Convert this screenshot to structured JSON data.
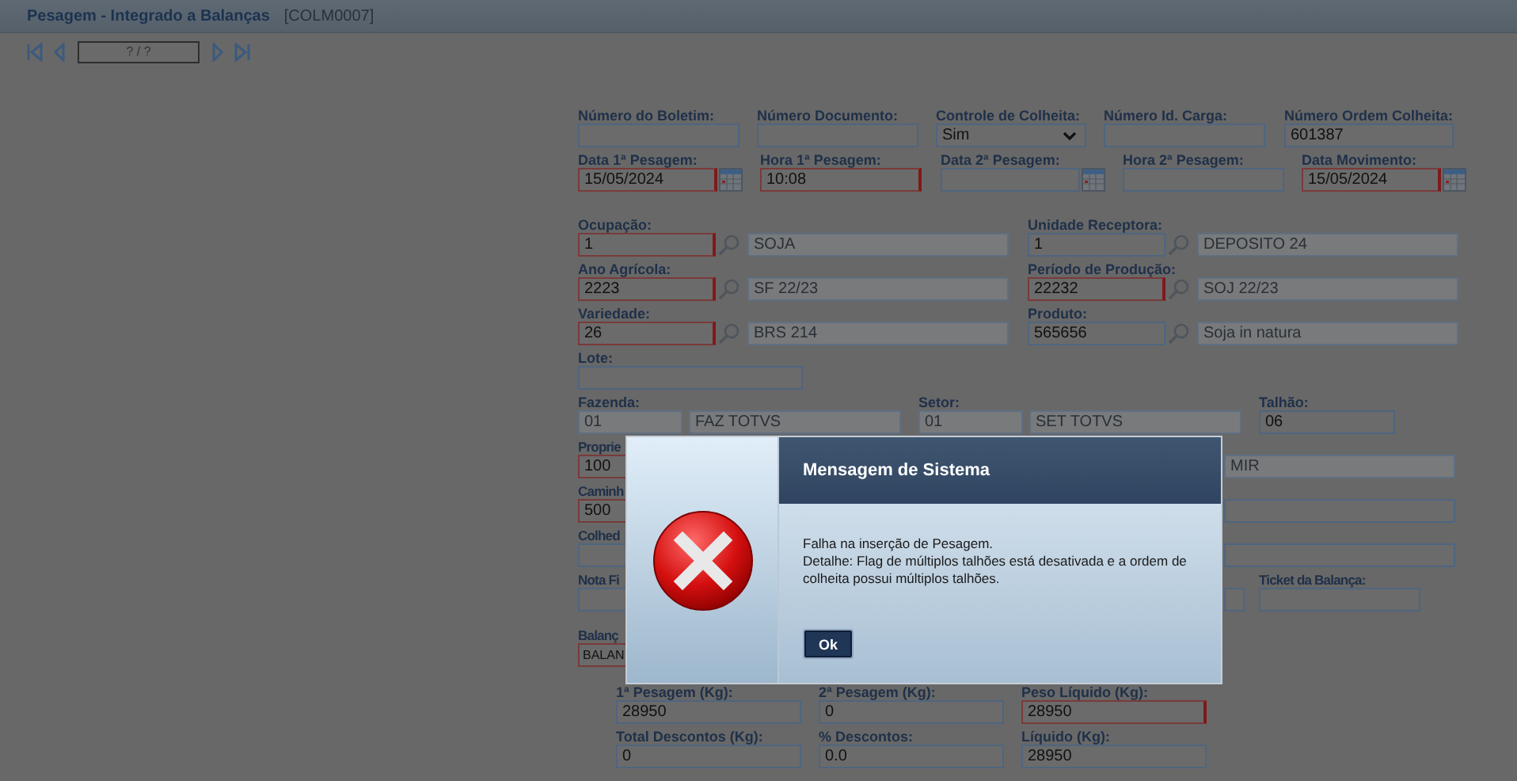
{
  "header": {
    "title": "Pesagem - Integrado a Balanças",
    "code": "[COLM0007]"
  },
  "pager": {
    "text": "? / ?"
  },
  "rows": [
    [
      {
        "kind": "text",
        "label": "Número do Boletim:",
        "required": false,
        "disabled": false
      },
      {
        "kind": "text",
        "label": "Número Documento:",
        "required": false,
        "disabled": false
      },
      {
        "kind": "select",
        "label": "Controle de Colheita:",
        "value": "Sim",
        "required": false,
        "disabled": false
      },
      {
        "kind": "text",
        "label": "Número Id. Carga:",
        "required": false,
        "disabled": false
      },
      {
        "kind": "text",
        "label": "Número Ordem Colheita:",
        "value": "601387",
        "required": false,
        "disabled": false
      }
    ],
    [
      {
        "kind": "date",
        "label": "Data 1ª Pesagem:",
        "value": "15/05/2024",
        "required": true,
        "disabled": false
      },
      {
        "kind": "text",
        "label": "Hora 1ª Pesagem:",
        "value": "10:08",
        "required": true,
        "disabled": false
      },
      {
        "kind": "date",
        "label": "Data 2ª Pesagem:",
        "required": false,
        "disabled": false
      },
      {
        "kind": "text",
        "label": "Hora 2ª Pesagem:",
        "required": false,
        "disabled": false
      },
      {
        "kind": "date",
        "label": "Data Movimento:",
        "value": "15/05/2024",
        "required": true,
        "disabled": false
      }
    ],
    [
      {
        "kind": "lookup",
        "label": "Ocupação:",
        "code": "1",
        "description": "SOJA",
        "required": true,
        "disabled": false
      },
      {
        "kind": "lookup",
        "label": "Unidade Receptora:",
        "code": "1",
        "description": "DEPOSITO 24",
        "required": false,
        "disabled": false
      }
    ],
    [
      {
        "kind": "lookup",
        "label": "Ano Agrícola:",
        "code": "2223",
        "description": "SF 22/23",
        "required": true,
        "disabled": false
      },
      {
        "kind": "lookup",
        "label": "Período de Produção:",
        "code": "22232",
        "description": "SOJ 22/23",
        "required": true,
        "disabled": false
      }
    ],
    [
      {
        "kind": "lookup",
        "label": "Variedade:",
        "code": "26",
        "description": "BRS 214",
        "required": true,
        "disabled": false
      },
      {
        "kind": "lookup",
        "label": "Produto:",
        "code": "565656",
        "description": "Soja in natura",
        "required": false,
        "disabled": false
      }
    ],
    [
      {
        "kind": "text",
        "label": "Lote:",
        "required": false,
        "disabled": false
      }
    ],
    [
      {
        "kind": "pair",
        "label": "Fazenda:",
        "code": "01",
        "description": "FAZ TOTVS",
        "required": false,
        "disabled": true
      },
      {
        "kind": "pair",
        "label": "Setor:",
        "code": "01",
        "description": "SET TOTVS",
        "required": false,
        "disabled": true
      },
      {
        "kind": "text",
        "label": "Talhão:",
        "value": "06",
        "required": false,
        "disabled": false
      }
    ],
    [
      {
        "kind": "text",
        "label": "Proprie",
        "value": "100",
        "required": true,
        "disabled": false
      },
      {
        "kind": "text",
        "value": "MIR",
        "required": false,
        "disabled": true
      }
    ],
    [
      {
        "kind": "text",
        "label": "Caminh",
        "value": "500",
        "required": true,
        "disabled": false
      },
      {
        "kind": "text",
        "required": false,
        "disabled": false
      }
    ],
    [
      {
        "kind": "text",
        "label": "Colhed",
        "required": false,
        "disabled": false
      },
      {
        "kind": "text",
        "required": false,
        "disabled": false
      }
    ],
    [
      {
        "kind": "text",
        "label": "Nota Fi",
        "required": false,
        "disabled": false
      },
      {
        "kind": "text",
        "required": false,
        "disabled": false
      },
      {
        "kind": "text",
        "label": "Ticket da Balança:",
        "required": false,
        "disabled": false
      }
    ],
    [
      {
        "kind": "text",
        "label": "Balanç",
        "value": "BALAN",
        "required": true,
        "disabled": false
      }
    ],
    [
      {
        "kind": "text",
        "label": "1ª Pesagem (Kg):",
        "value": "28950",
        "required": false,
        "disabled": false
      },
      {
        "kind": "text",
        "label": "2ª Pesagem (Kg):",
        "value": "0",
        "required": false,
        "disabled": false
      },
      {
        "kind": "text",
        "label": "Peso Líquido (Kg):",
        "value": "28950",
        "required": true,
        "disabled": false
      }
    ],
    [
      {
        "kind": "text",
        "label": "Total Descontos (Kg):",
        "value": "0",
        "required": false,
        "disabled": false
      },
      {
        "kind": "text",
        "label": "% Descontos:",
        "value": "0.0",
        "required": false,
        "disabled": false
      },
      {
        "kind": "text",
        "label": "Líquido (Kg):",
        "value": "28950",
        "required": false,
        "disabled": false
      }
    ]
  ],
  "dialog": {
    "title": "Mensagem de Sistema",
    "message": "Falha na inserção de Pesagem.",
    "detail": "Detalhe: Flag de múltiplos talhões está desativada e a ordem de colheita possui múltiplos talhões.",
    "button": "Ok"
  }
}
